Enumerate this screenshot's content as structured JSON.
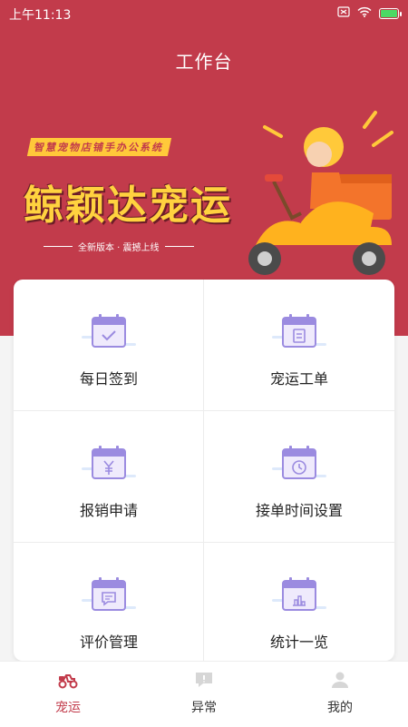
{
  "status_bar": {
    "time": "上午11:13"
  },
  "header": {
    "title": "工作台"
  },
  "banner": {
    "tagline": "智慧宠物店铺手办公系统",
    "brand": "鲸颖达宠运",
    "subtitle": "全新版本 · 震撼上线"
  },
  "grid": {
    "items": [
      {
        "label": "每日签到",
        "icon": "calendar-check-icon"
      },
      {
        "label": "宠运工单",
        "icon": "calendar-doc-icon"
      },
      {
        "label": "报销申请",
        "icon": "calendar-yen-icon"
      },
      {
        "label": "接单时间设置",
        "icon": "calendar-clock-icon"
      },
      {
        "label": "评价管理",
        "icon": "calendar-chat-icon"
      },
      {
        "label": "统计一览",
        "icon": "calendar-chart-icon"
      }
    ]
  },
  "tab_bar": {
    "tabs": [
      {
        "label": "宠运",
        "icon": "scooter-icon",
        "active": true
      },
      {
        "label": "异常",
        "icon": "alert-chat-icon",
        "active": false
      },
      {
        "label": "我的",
        "icon": "user-icon",
        "active": false
      }
    ]
  },
  "colors": {
    "brand": "#c23b4b",
    "accent": "#ffd23f",
    "icon_purple": "#9b8be0"
  }
}
